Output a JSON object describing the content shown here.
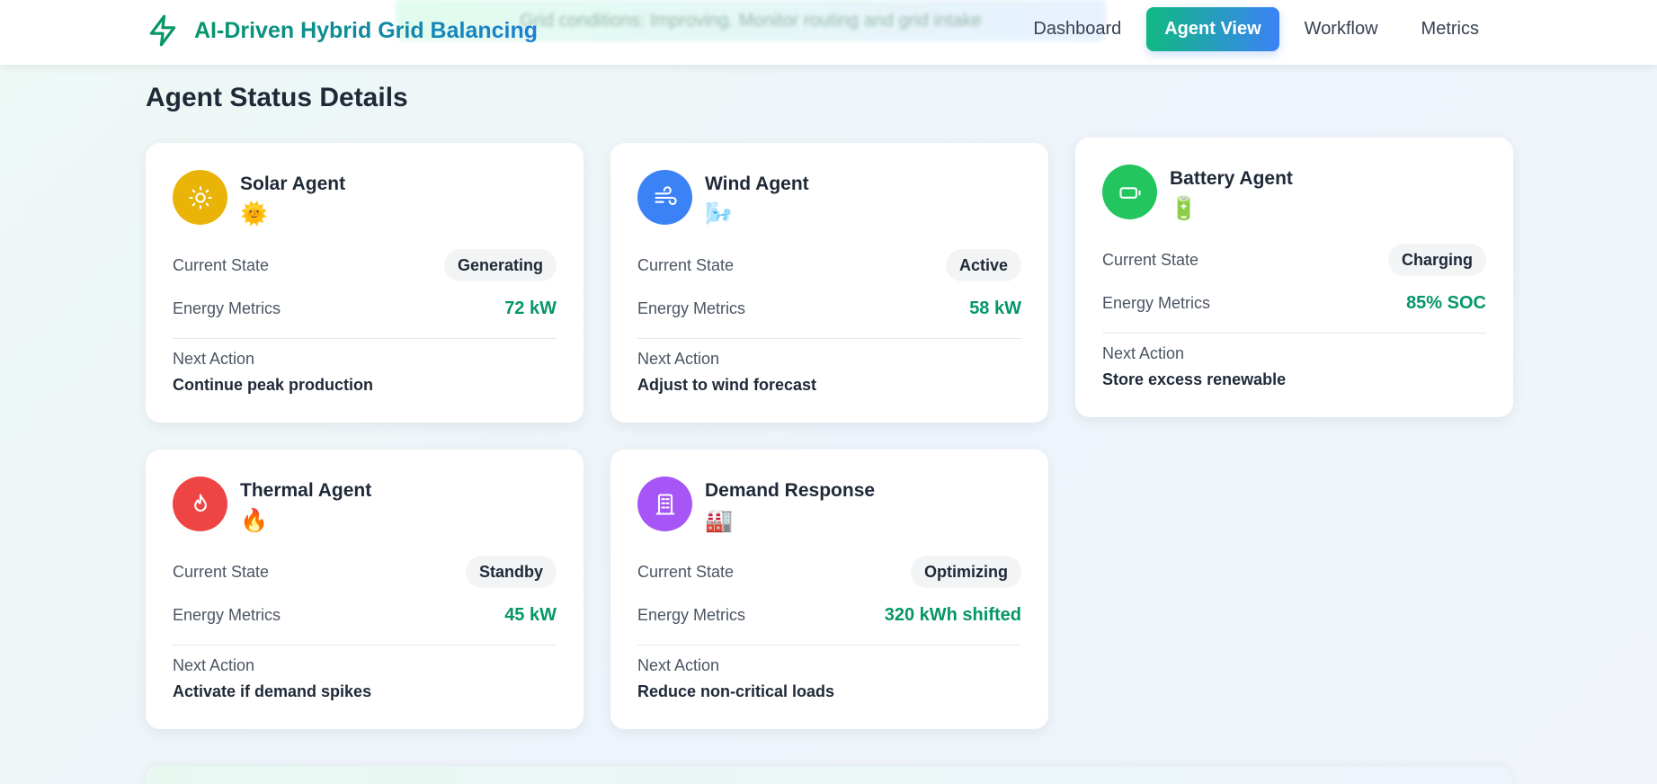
{
  "app": {
    "title": "AI-Driven Hybrid Grid Balancing",
    "toast": "Grid conditions: Improving. Monitor routing and grid intake"
  },
  "nav": {
    "items": [
      {
        "label": "Dashboard",
        "active": false
      },
      {
        "label": "Agent View",
        "active": true
      },
      {
        "label": "Workflow",
        "active": false
      },
      {
        "label": "Metrics",
        "active": false
      }
    ]
  },
  "section": {
    "title": "Agent Status Details"
  },
  "labels": {
    "current_state": "Current State",
    "energy_metrics": "Energy Metrics",
    "next_action": "Next Action"
  },
  "agents": [
    {
      "name": "Solar Agent",
      "emoji": "🌞",
      "state": "Generating",
      "metric": "72 kW",
      "next_action": "Continue peak production",
      "icon": "sun-icon",
      "color": "#eab308"
    },
    {
      "name": "Wind Agent",
      "emoji": "🌬️",
      "state": "Active",
      "metric": "58 kW",
      "next_action": "Adjust to wind forecast",
      "icon": "wind-icon",
      "color": "#3b82f6"
    },
    {
      "name": "Battery Agent",
      "emoji": "🔋",
      "state": "Charging",
      "metric": "85% SOC",
      "next_action": "Store excess renewable",
      "icon": "battery-icon",
      "color": "#22c55e"
    },
    {
      "name": "Thermal Agent",
      "emoji": "🔥",
      "state": "Standby",
      "metric": "45 kW",
      "next_action": "Activate if demand spikes",
      "icon": "flame-icon",
      "color": "#ef4444"
    },
    {
      "name": "Demand Response",
      "emoji": "🏭",
      "state": "Optimizing",
      "metric": "320 kWh shifted",
      "next_action": "Reduce non-critical loads",
      "icon": "building-icon",
      "color": "#a855f7"
    }
  ],
  "colors": {
    "accent_green": "#059669",
    "accent_blue": "#3b82f6"
  }
}
